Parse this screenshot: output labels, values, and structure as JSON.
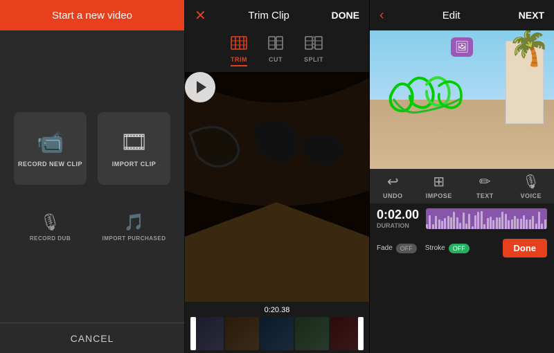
{
  "panel1": {
    "header_title": "Start a new video",
    "record_btn_label": "RECORD NEW CLIP",
    "import_btn_label": "IMPORT CLIP",
    "record_dub_label": "RECORD DUB",
    "import_purchased_label": "IMPORT PURCHASED",
    "cancel_label": "CANCEL"
  },
  "panel2": {
    "header_title": "Trim Clip",
    "done_label": "DONE",
    "tab_trim": "TRIM",
    "tab_cut": "CUT",
    "tab_split": "SPLIT",
    "timestamp": "0:20.38"
  },
  "panel3": {
    "header_title": "Edit",
    "next_label": "NEXT",
    "tool_undo": "UNDO",
    "tool_impose": "IMPOSE",
    "tool_text": "TEXT",
    "tool_voice": "VOICE",
    "duration_time": "0:02.00",
    "duration_label": "DURATION",
    "fade_label": "Fade",
    "fade_state": "OFF",
    "stroke_label": "Stroke",
    "stroke_state": "OFF",
    "done_label": "Done"
  }
}
